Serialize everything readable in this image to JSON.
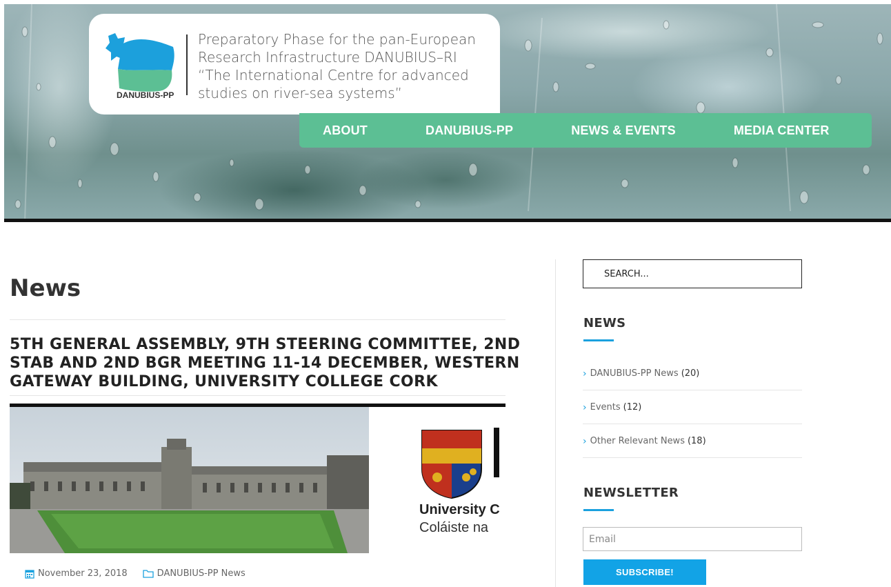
{
  "header": {
    "logo_text": "DANUBIUS-PP",
    "tagline": [
      "Preparatory Phase for the pan-European",
      "Research Infrastructure DANUBIUS–RI",
      "“The International Centre for advanced",
      "studies on river-sea systems”"
    ],
    "nav": [
      "ABOUT",
      "DANUBIUS-PP",
      "NEWS & EVENTS",
      "MEDIA CENTER"
    ]
  },
  "main": {
    "page_title": "News",
    "article": {
      "title_lines": [
        "5TH GENERAL ASSEMBLY, 9TH STEERING COMMITTEE, 2ND",
        "STAB AND 2ND BGR MEETING 11-14 DECEMBER, WESTERN",
        "GATEWAY BUILDING, UNIVERSITY COLLEGE CORK"
      ],
      "image_text": {
        "name": "University C",
        "irish": "Coláiste na"
      },
      "date": "November 23, 2018",
      "category": "DANUBIUS-PP News"
    }
  },
  "sidebar": {
    "search_placeholder": "SEARCH...",
    "news_title": "NEWS",
    "categories": [
      {
        "label": "DANUBIUS-PP News",
        "count": "(20)"
      },
      {
        "label": "Events",
        "count": "(12)"
      },
      {
        "label": "Other Relevant News",
        "count": "(18)"
      }
    ],
    "newsletter_title": "NEWSLETTER",
    "email_placeholder": "Email",
    "subscribe_label": "SUBSCRIBE!"
  },
  "colors": {
    "nav_green": "#5cbf94",
    "accent_blue": "#1aa1de",
    "subscribe_blue": "#12a3e6"
  }
}
